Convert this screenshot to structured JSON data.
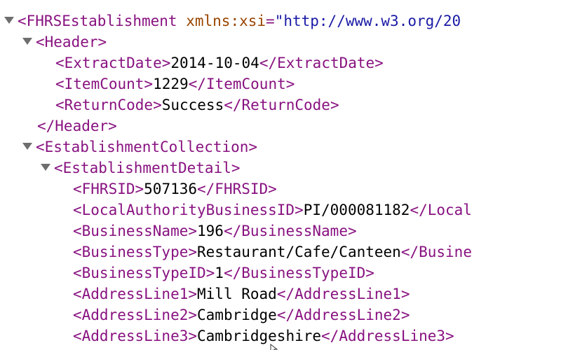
{
  "xml": {
    "root": {
      "open": "<FHRSEstablishment",
      "attr_name": "xmlns:xsi",
      "attr_eq": "=",
      "attr_value": "\"http://www.w3.org/20"
    },
    "header": {
      "open": "<Header>",
      "close": "</Header>",
      "extract_date": {
        "open": "<ExtractDate>",
        "value": "2014-10-04",
        "close": "</ExtractDate>"
      },
      "item_count": {
        "open": "<ItemCount>",
        "value": "1229",
        "close": "</ItemCount>"
      },
      "return_code": {
        "open": "<ReturnCode>",
        "value": "Success",
        "close": "</ReturnCode>"
      }
    },
    "collection": {
      "open": "<EstablishmentCollection>"
    },
    "detail": {
      "open": "<EstablishmentDetail>",
      "fhrsid": {
        "open": "<FHRSID>",
        "value": "507136",
        "close": "</FHRSID>"
      },
      "la_business_id": {
        "open": "<LocalAuthorityBusinessID>",
        "value": "PI/000081182",
        "close": "</Local"
      },
      "business_name": {
        "open": "<BusinessName>",
        "value": "196",
        "close": "</BusinessName>"
      },
      "business_type": {
        "open": "<BusinessType>",
        "value": "Restaurant/Cafe/Canteen",
        "close": "</Busine"
      },
      "business_type_id": {
        "open": "<BusinessTypeID>",
        "value": "1",
        "close": "</BusinessTypeID>"
      },
      "address_line1": {
        "open": "<AddressLine1>",
        "value": "Mill Road",
        "close": "</AddressLine1>"
      },
      "address_line2": {
        "open": "<AddressLine2>",
        "value": "Cambridge",
        "close": "</AddressLine2>"
      },
      "address_line3": {
        "open": "<AddressLine3>",
        "value": "Cambridgeshire",
        "close": "</AddressLine3>"
      }
    }
  },
  "colors": {
    "tag": "#881280",
    "attribute_name": "#994500",
    "attribute_value": "#1a1aa6",
    "text": "#000000",
    "toggle_arrow": "#6e6e6e"
  },
  "icons": {
    "toggle": "triangle-down-icon",
    "cursor": "pointer-cursor-icon"
  }
}
